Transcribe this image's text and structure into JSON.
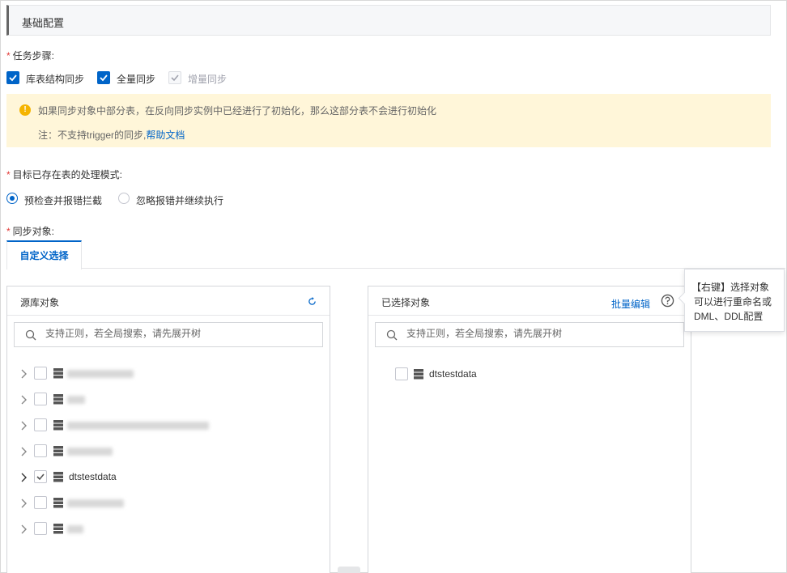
{
  "section": {
    "title": "基础配置"
  },
  "task_steps": {
    "label": "任务步骤:",
    "options": [
      {
        "label": "库表结构同步",
        "state": "checked"
      },
      {
        "label": "全量同步",
        "state": "checked"
      },
      {
        "label": "增量同步",
        "state": "disabled-checked"
      }
    ]
  },
  "alert": {
    "message": "如果同步对象中部分表，在反向同步实例中已经进行了初始化，那么这部分表不会进行初始化",
    "note_prefix": "注：不支持trigger的同步,",
    "note_link": "帮助文档"
  },
  "existing_table_mode": {
    "label": "目标已存在表的处理模式:",
    "options": [
      {
        "label": "预检查并报错拦截",
        "selected": true
      },
      {
        "label": "忽略报错并继续执行",
        "selected": false
      }
    ]
  },
  "sync_objects": {
    "label": "同步对象:",
    "tab": "自定义选择"
  },
  "source_panel": {
    "title": "源库对象",
    "search_placeholder": "支持正则，若全局搜索，请先展开树",
    "items": [
      {
        "text": "",
        "checked": false,
        "blurred": true
      },
      {
        "text": "",
        "checked": false,
        "blurred": true
      },
      {
        "text": "",
        "checked": false,
        "blurred": true
      },
      {
        "text": "",
        "checked": false,
        "blurred": true
      },
      {
        "text": "dtstestdata",
        "checked": true,
        "blurred": false
      },
      {
        "text": "",
        "checked": false,
        "blurred": true
      },
      {
        "text": "",
        "checked": false,
        "blurred": true
      }
    ]
  },
  "selected_panel": {
    "title": "已选择对象",
    "batch_edit": "批量编辑",
    "search_placeholder": "支持正则，若全局搜索，请先展开树",
    "items": [
      {
        "text": "dtstestdata",
        "checked": false
      }
    ]
  },
  "tooltip": {
    "line1": "【右键】选择对象",
    "line2": "可以进行重命名或",
    "line3": "DML、DDL配置"
  },
  "colors": {
    "primary": "#0064c8",
    "required": "#e23c39",
    "alert_bg": "#fff6d9"
  }
}
